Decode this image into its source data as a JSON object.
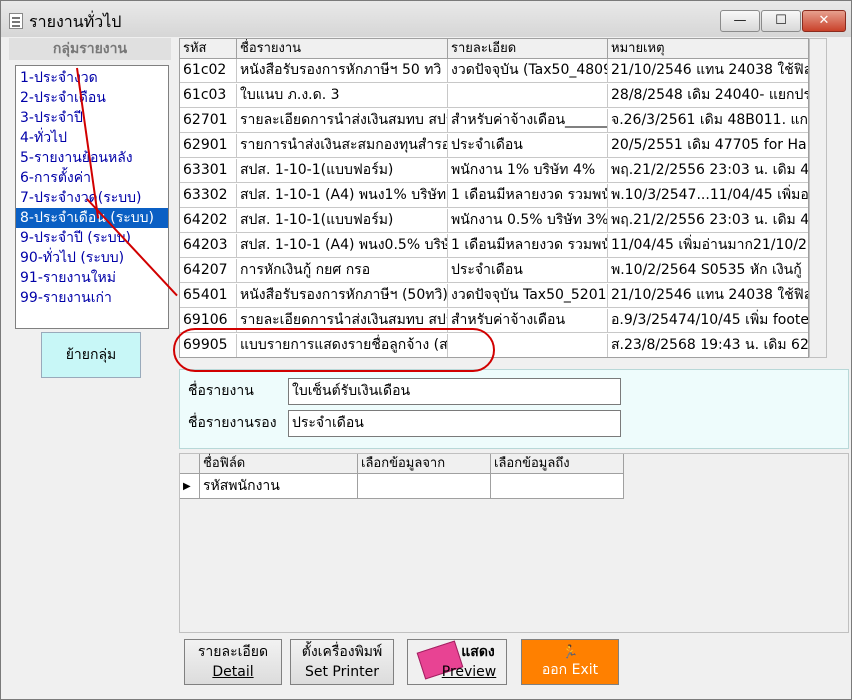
{
  "window": {
    "title": "รายงานทั่วไป",
    "min_label": "—",
    "max_label": "☐",
    "close_label": "✕"
  },
  "left": {
    "header": "กลุ่มรายงาน",
    "groups": [
      "1-ประจำงวด",
      "2-ประจำเดือน",
      "3-ประจำปี",
      "4-ทั่วไป",
      "5-รายงานย้อนหลัง",
      "6-การตั้งค่า",
      "7-ประจำงวด(ระบบ)",
      "8-ประจำเดือน (ระบบ)",
      "9-ประจำปี (ระบบ)",
      "90-ทั่วไป (ระบบ)",
      "91-รายงานใหม่",
      "99-รายงานเก่า"
    ],
    "selected_index": 7,
    "move_button": "ย้ายกลุ่ม"
  },
  "grid": {
    "headers": [
      "รหัส",
      "ชื่อรายงาน",
      "รายละเอียด",
      "หมายเหตุ"
    ],
    "rows": [
      [
        "61c02",
        "หนังสือรับรองการหักภาษีฯ 50 ทวิ",
        "งวดปัจจุบัน (Tax50_4809",
        "21/10/2546 แทน 24038 ใช้ฟิล"
      ],
      [
        "61c03",
        "ใบแนบ ภ.ง.ด. 3",
        "",
        "28/8/2548 เดิม 24040- แยกปร"
      ],
      [
        "62701",
        "รายละเอียดการนำส่งเงินสมทบ สปส",
        "สำหรับค่าจ้างเดือน______",
        "จ.26/3/2561  เดิม 48B011. แก"
      ],
      [
        "62901",
        "รายการนำส่งเงินสะสมกองทุนสำรอง",
        "ประจำเดือน",
        "20/5/2551 เดิม 47705 for Ha"
      ],
      [
        "63301",
        "สปส. 1-10-1(แบบฟอร์ม)",
        "พนักงาน 1% บริษัท 4%",
        "พฤ.21/2/2556  23:03 น. เดิม 4"
      ],
      [
        "63302",
        "สปส. 1-10-1 (A4) พนง1% บริษัท",
        "1 เดือนมีหลายงวด รวมพนัก",
        "พ.10/3/2547...11/04/45 เพิ่มอ"
      ],
      [
        "64202",
        "สปส. 1-10-1(แบบฟอร์ม)",
        "พนักงาน 0.5% บริษัท 3%",
        "พฤ.21/2/2556  23:03 น. เดิม 4"
      ],
      [
        "64203",
        "สปส. 1-10-1 (A4) พนง0.5% บริษั",
        "1 เดือนมีหลายงวด รวมพนัก",
        "11/04/45 เพิ่มอ่านมาก21/10/25"
      ],
      [
        "64207",
        "การหักเงินกู้ กยศ กรอ",
        "ประจำเดือน",
        "พ.10/2/2564 S0535 หัก เงินกู้"
      ],
      [
        "65401",
        "หนังสือรับรองการหักภาษีฯ (50ทวิ)",
        "งวดปัจจุบัน Tax50_5201",
        "21/10/2546 แทน 24038 ใช้ฟิล"
      ],
      [
        "69106",
        "รายละเอียดการนำส่งเงินสมทบ สปส",
        "สำหรับค่าจ้างเดือน",
        "อ.9/3/25474/10/45 เพิ่ม foote"
      ],
      [
        "69905",
        "แบบรายการแสดงรายชื่อลูกจ้าง (สถ",
        "",
        "ส.23/8/2568  19:43 น. เดิม 62"
      ]
    ]
  },
  "detail": {
    "name_label": "ชื่อรายงาน",
    "name_value": "ใบเซ็นต์รับเงินเดือน",
    "subname_label": "ชื่อรายงานรอง",
    "subname_value": "ประจำเดือน"
  },
  "fields": {
    "headers": [
      "ชื่อฟิล์ด",
      "เลือกข้อมูลจาก",
      "เลือกข้อมูลถึง"
    ],
    "rows": [
      [
        "รหัสพนักงาน",
        "",
        ""
      ]
    ],
    "row_marker": "▶"
  },
  "buttons": {
    "detail_line1": "รายละเอียด",
    "detail_line2": "Detail",
    "printer_line1": "ตั้งเครื่องพิมพ์",
    "printer_line2": "Set Printer",
    "preview_line1": "แสดง",
    "preview_line2": "Preview",
    "exit_line2": "ออก  Exit",
    "exit_icon": "🏃"
  },
  "colors": {
    "selected_bg": "#0a5fc4",
    "group_text": "#0000a8",
    "annotation": "#d10000",
    "exit_bg": "#ff8000",
    "move_bg": "#c8f7f7"
  }
}
